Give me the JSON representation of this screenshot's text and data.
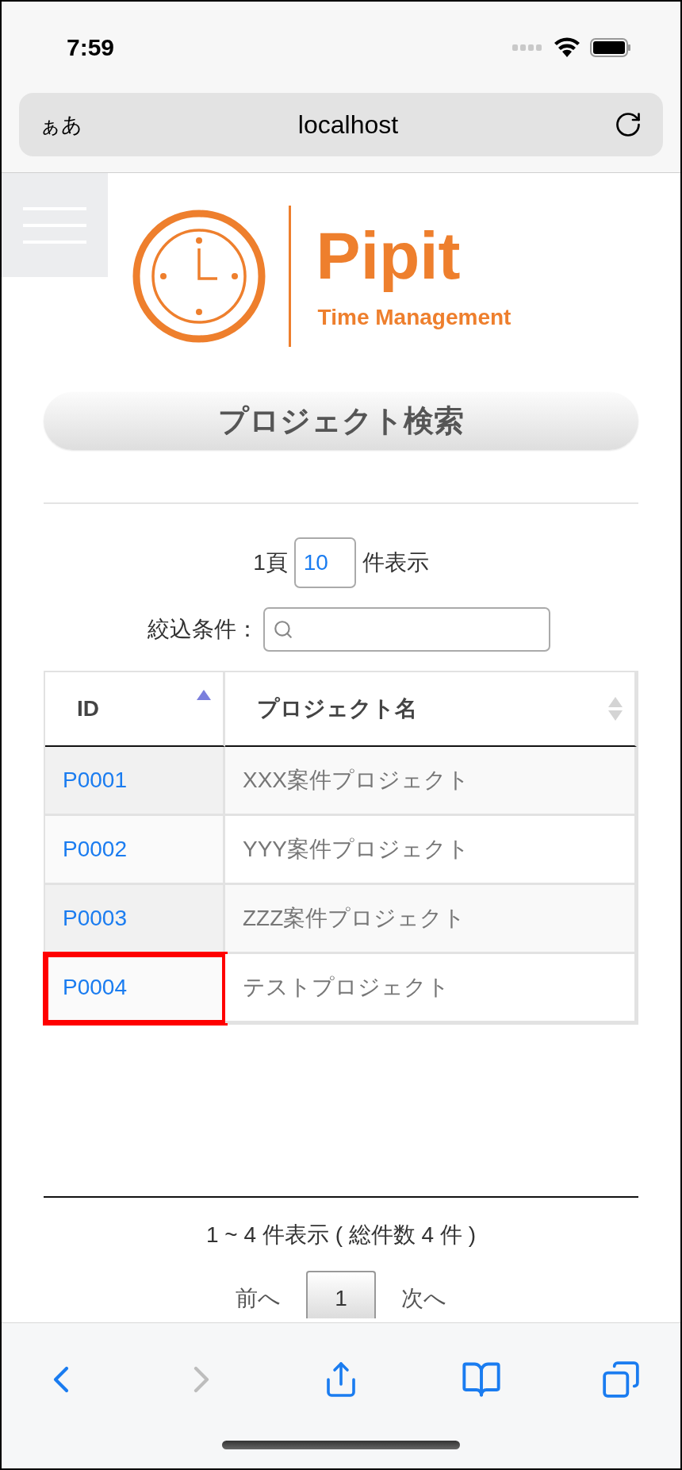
{
  "status_bar": {
    "time": "7:59"
  },
  "browser": {
    "text_size_label": "ぁあ",
    "address": "localhost"
  },
  "logo": {
    "name": "Pipit",
    "tagline": "Time Management"
  },
  "page_title": "プロジェクト検索",
  "page_size": {
    "prefix": "1頁",
    "value": "10",
    "suffix": "件表示"
  },
  "filter": {
    "label": "絞込条件："
  },
  "table": {
    "columns": [
      {
        "label": "ID",
        "sorted": true
      },
      {
        "label": "プロジェクト名",
        "sorted": false
      }
    ],
    "rows": [
      {
        "id": "P0001",
        "name": "XXX案件プロジェクト",
        "highlighted": false
      },
      {
        "id": "P0002",
        "name": "YYY案件プロジェクト",
        "highlighted": false
      },
      {
        "id": "P0003",
        "name": "ZZZ案件プロジェクト",
        "highlighted": false
      },
      {
        "id": "P0004",
        "name": "テストプロジェクト",
        "highlighted": true
      }
    ]
  },
  "summary": "1 ~ 4 件表示 ( 総件数 4 件 )",
  "pagination": {
    "previous": "前へ",
    "pages": [
      {
        "label": "1",
        "selected": true
      }
    ],
    "next": "次へ"
  },
  "toolbar": [
    {
      "kind": "back",
      "disabled": false
    },
    {
      "kind": "forward",
      "disabled": true
    },
    {
      "kind": "share",
      "disabled": false
    },
    {
      "kind": "bookmarks",
      "disabled": false
    },
    {
      "kind": "tabs",
      "disabled": false
    }
  ]
}
